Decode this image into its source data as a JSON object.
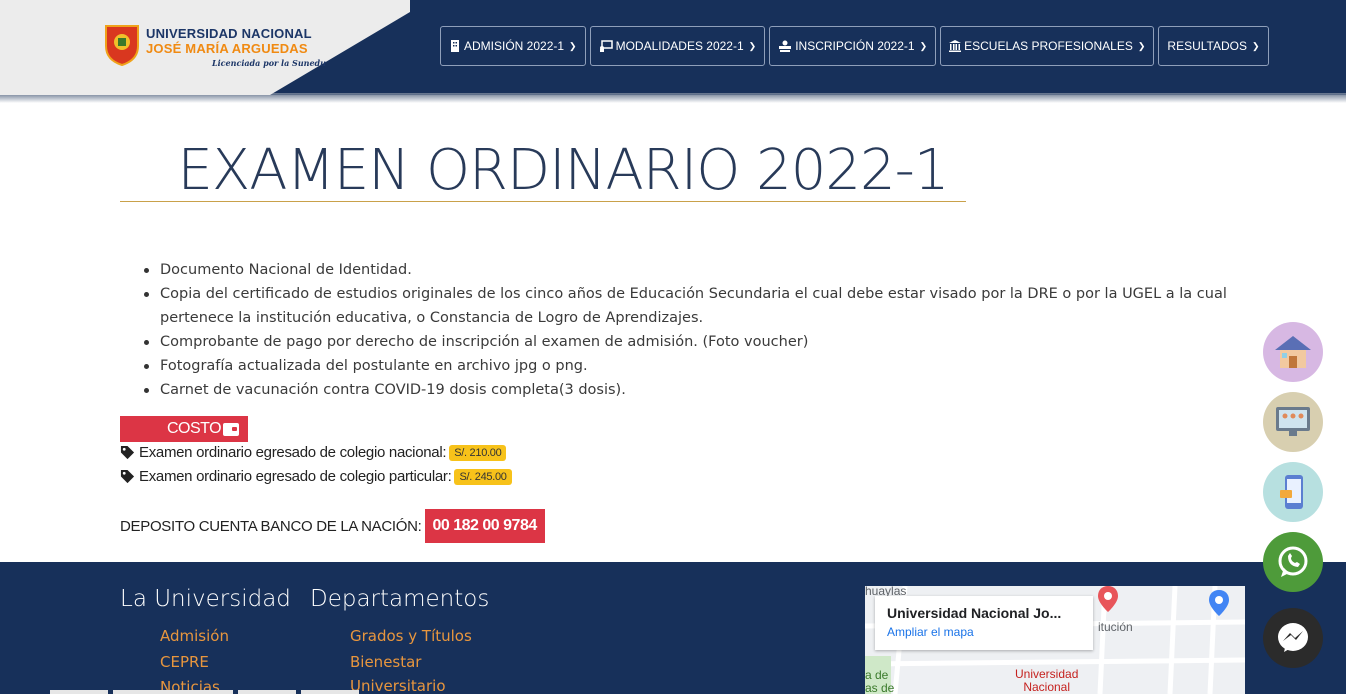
{
  "logo": {
    "line1": "UNIVERSIDAD NACIONAL",
    "line2": "JOSÉ MARÍA ARGUEDAS",
    "tagline": "Licenciada por la Sunedu"
  },
  "nav": [
    {
      "label": "ADMISIÓN 2022-1",
      "icon": "building-icon"
    },
    {
      "label": "MODALIDADES 2022-1",
      "icon": "chalkboard-icon"
    },
    {
      "label": "INSCRIPCIÓN 2022-1",
      "icon": "user-pen-icon"
    },
    {
      "label": "ESCUELAS PROFESIONALES",
      "icon": "university-icon"
    },
    {
      "label": "RESULTADOS",
      "icon": ""
    }
  ],
  "page": {
    "title": "EXAMEN ORDINARIO 2022-1",
    "requirements": [
      "Documento Nacional de Identidad.",
      "Copia del certificado de estudios originales de los cinco años de Educación Secundaria el cual debe estar visado por la DRE o por la UGEL a la cual pertenece la institución educativa, o Constancia de Logro de Aprendizajes.",
      "Comprobante de pago por derecho de inscripción al examen de admisión. (Foto voucher)",
      "Fotografía actualizada del postulante en archivo jpg o png.",
      "Carnet de vacunación contra COVID-19 dosis completa(3 dosis)."
    ],
    "costo_label": "COSTO",
    "prices": [
      {
        "label": "Examen ordinario egresado de colegio nacional:",
        "amount": "S/. 210.00"
      },
      {
        "label": "Examen ordinario egresado de colegio particular:",
        "amount": "S/. 245.00"
      }
    ],
    "deposit_label": "DEPOSITO CUENTA BANCO DE LA NACIÓN:",
    "deposit_account": "00 182 00 9784"
  },
  "footer": {
    "col1_title": "La Universidad",
    "col1_links": [
      "Admisión",
      "CEPRE",
      "Noticias"
    ],
    "col2_title": "Departamentos",
    "col2_links": [
      "Grados y Títulos",
      "Bienestar",
      "Universitario"
    ],
    "map": {
      "place_title": "Universidad Nacional Jo...",
      "enlarge_link": "Ampliar el mapa",
      "label_top": "huaylas",
      "label_street": "itución",
      "label_left1": "a de",
      "label_left2": "as de",
      "pin_label_line1": "Universidad",
      "pin_label_line2": "Nacional"
    }
  },
  "floating_buttons": [
    {
      "name": "home-icon",
      "bg": "#d7b8e3"
    },
    {
      "name": "classroom-icon",
      "bg": "#d8cfb0"
    },
    {
      "name": "mobile-pay-icon",
      "bg": "#b7e0e0"
    },
    {
      "name": "whatsapp-icon",
      "bg": "#4e9b3a"
    },
    {
      "name": "messenger-icon",
      "bg": "#2b2b2b"
    }
  ],
  "colors": {
    "navy": "#17305a",
    "red": "#dc3545",
    "gold": "#f7c21a",
    "footer_link": "#e8963e"
  }
}
